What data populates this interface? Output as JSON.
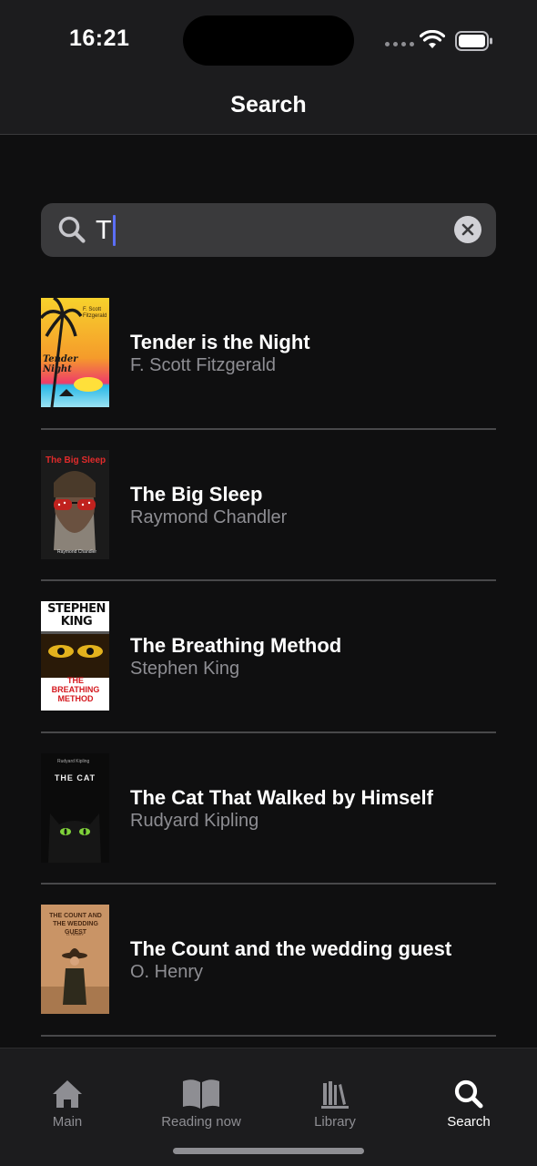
{
  "status_bar": {
    "time": "16:21"
  },
  "header": {
    "title": "Search"
  },
  "search": {
    "value": "T"
  },
  "results": [
    {
      "title": "Tender is the Night",
      "author": "F. Scott Fitzgerald",
      "cover_text": "Tender Night",
      "cover_author": "F. Scott Fitzgerald"
    },
    {
      "title": "The Big Sleep",
      "author": "Raymond Chandler",
      "cover_text": "The Big Sleep",
      "cover_author": "Raymond Chandler"
    },
    {
      "title": "The Breathing Method",
      "author": "Stephen King",
      "cover_text": "THE BREATHING METHOD",
      "cover_author": "STEPHEN KING"
    },
    {
      "title": "The Cat That Walked by Himself",
      "author": "Rudyard Kipling",
      "cover_text": "THE CAT",
      "cover_author": "Rudyard Kipling"
    },
    {
      "title": "The Count and the wedding guest",
      "author": "O. Henry",
      "cover_text": "THE COUNT AND THE WEDDING GUEST",
      "cover_author": "O. HENRY"
    }
  ],
  "tab_bar": {
    "tabs": [
      {
        "label": "Main",
        "icon": "house-icon",
        "active": false
      },
      {
        "label": "Reading now",
        "icon": "open-book-icon",
        "active": false
      },
      {
        "label": "Library",
        "icon": "books-icon",
        "active": false
      },
      {
        "label": "Search",
        "icon": "magnifier-icon",
        "active": true
      }
    ]
  },
  "colors": {
    "background": "#0f0f10",
    "bar_background": "#1c1c1e",
    "search_field": "#3a3a3c",
    "secondary_text": "#8e8e93",
    "caret": "#5b6ef5"
  }
}
